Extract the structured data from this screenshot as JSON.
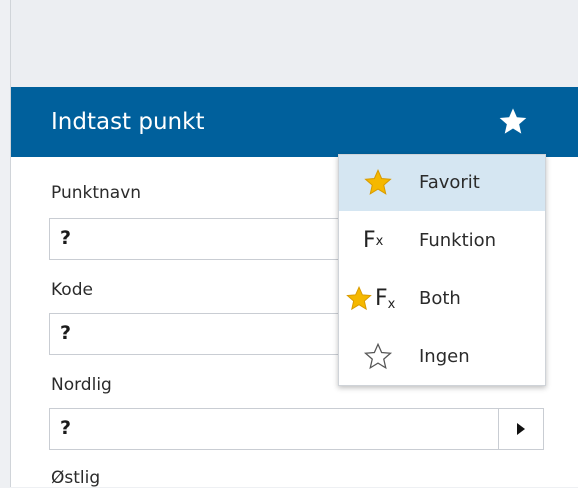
{
  "header": {
    "title": "Indtast punkt",
    "favorite_icon": "star-icon"
  },
  "fields": [
    {
      "label": "Punktnavn",
      "value": "?"
    },
    {
      "label": "Kode",
      "value": "?"
    },
    {
      "label": "Nordlig",
      "value": "?"
    },
    {
      "label": "Østlig"
    }
  ],
  "dropdown": {
    "options": [
      {
        "label": "Favorit",
        "icon": "star-filled-icon",
        "selected": true
      },
      {
        "label": "Funktion",
        "icon": "fx-icon",
        "fx_main": "F",
        "fx_sub": "x"
      },
      {
        "label": "Both",
        "icon": "star-fx-icon",
        "fx_main": "F",
        "fx_sub": "x"
      },
      {
        "label": "Ingen",
        "icon": "star-outline-icon"
      }
    ]
  },
  "colors": {
    "header_bg": "#00609c",
    "star_gold": "#f5b800",
    "selected_bg": "#d5e6f2"
  }
}
